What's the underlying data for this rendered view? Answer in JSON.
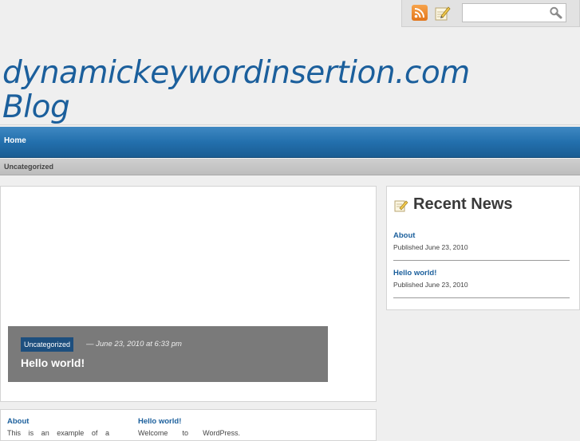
{
  "header": {
    "site_title": "dynamickeywordinsertion.com Blog",
    "search": {
      "placeholder": "",
      "value": ""
    },
    "icons": [
      "rss-icon",
      "write-icon",
      "search-icon"
    ]
  },
  "nav": {
    "items": [
      {
        "label": "Home"
      }
    ]
  },
  "subnav": {
    "items": [
      {
        "label": "Uncategorized"
      }
    ]
  },
  "featured": {
    "category": "Uncategorized",
    "meta": "— June 23, 2010 at 6:33 pm",
    "title": "Hello world!"
  },
  "sidebar": {
    "title": "Recent News",
    "items": [
      {
        "title": "About",
        "published": "Published June 23, 2010"
      },
      {
        "title": "Hello world!",
        "published": "Published June 23, 2010"
      }
    ]
  },
  "excerpts": [
    {
      "title": "About",
      "text": "This is an example of a"
    },
    {
      "title": "Hello world!",
      "text": "Welcome to WordPress."
    }
  ],
  "colors": {
    "accent": "#1b5f9c",
    "nav_blue": "#2370ad",
    "caption_gray": "#7a7a7a",
    "badge": "#1d4f7e",
    "rss_orange": "#e2761b"
  }
}
